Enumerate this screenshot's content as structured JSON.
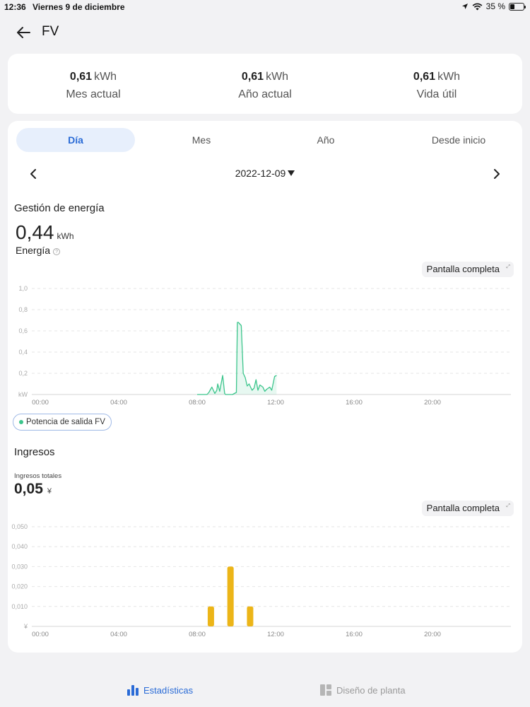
{
  "status_bar": {
    "time": "12:36",
    "date": "Viernes 9 de diciembre",
    "battery": "35 %",
    "battery_level": 0.35
  },
  "header": {
    "title": "FV"
  },
  "summary": [
    {
      "value": "0,61",
      "unit": "kWh",
      "label": "Mes actual"
    },
    {
      "value": "0,61",
      "unit": "kWh",
      "label": "Año actual"
    },
    {
      "value": "0,61",
      "unit": "kWh",
      "label": "Vida útil"
    }
  ],
  "tabs": [
    {
      "label": "Día",
      "active": true
    },
    {
      "label": "Mes",
      "active": false
    },
    {
      "label": "Año",
      "active": false
    },
    {
      "label": "Desde inicio",
      "active": false
    }
  ],
  "date_nav": {
    "date": "2022-12-09"
  },
  "energy": {
    "title": "Gestión de energía",
    "value": "0,44",
    "unit": "kWh",
    "label": "Energía",
    "fullscreen": "Pantalla completa"
  },
  "income": {
    "title": "Ingresos",
    "label": "Ingresos totales",
    "value": "0,05",
    "unit": "¥",
    "fullscreen": "Pantalla completa"
  },
  "chart_data": [
    {
      "type": "area",
      "ylabel": "kW",
      "ylim": [
        0,
        1.0
      ],
      "yticks": [
        "1,0",
        "0,8",
        "0,6",
        "0,4",
        "0,2",
        "kW"
      ],
      "xticks": [
        "00:00",
        "04:00",
        "08:00",
        "12:00",
        "16:00",
        "20:00"
      ],
      "x_hours": [
        8.0,
        8.5,
        8.6,
        8.75,
        8.9,
        9.0,
        9.05,
        9.15,
        9.3,
        9.4,
        9.45,
        9.55,
        9.7,
        9.8,
        10.0,
        10.05,
        10.1,
        10.25,
        10.35,
        10.45,
        10.55,
        10.65,
        10.8,
        10.9,
        11.0,
        11.1,
        11.2,
        11.35,
        11.45,
        11.55,
        11.7,
        11.8,
        11.95,
        12.05
      ],
      "series": [
        {
          "name": "Potencia de salida FV",
          "color": "#3cc58c",
          "values": [
            0,
            0,
            0.02,
            0.07,
            0.01,
            0.04,
            0.1,
            0.03,
            0.18,
            0.01,
            0,
            0,
            0,
            0,
            0.02,
            0.68,
            0.68,
            0.65,
            0.2,
            0.16,
            0.08,
            0.1,
            0.04,
            0.06,
            0.14,
            0.04,
            0.09,
            0.07,
            0.03,
            0.05,
            0.07,
            0.04,
            0.17,
            0.18
          ]
        }
      ],
      "legend": "bottom-left"
    },
    {
      "type": "bar",
      "ylabel": "¥",
      "ylim": [
        0,
        0.05
      ],
      "yticks": [
        "0,050",
        "0,040",
        "0,030",
        "0,020",
        "0,010",
        "¥"
      ],
      "xticks": [
        "00:00",
        "04:00",
        "08:00",
        "12:00",
        "16:00",
        "20:00"
      ],
      "x_hours": [
        8.7,
        9.7,
        10.7
      ],
      "series": [
        {
          "color": "#ecb518",
          "values": [
            0.01,
            0.03,
            0.01
          ]
        }
      ]
    }
  ],
  "bottom_nav": [
    {
      "label": "Estadísticas",
      "active": true,
      "icon": "bar-chart-icon"
    },
    {
      "label": "Diseño de planta",
      "active": false,
      "icon": "layout-icon"
    }
  ]
}
